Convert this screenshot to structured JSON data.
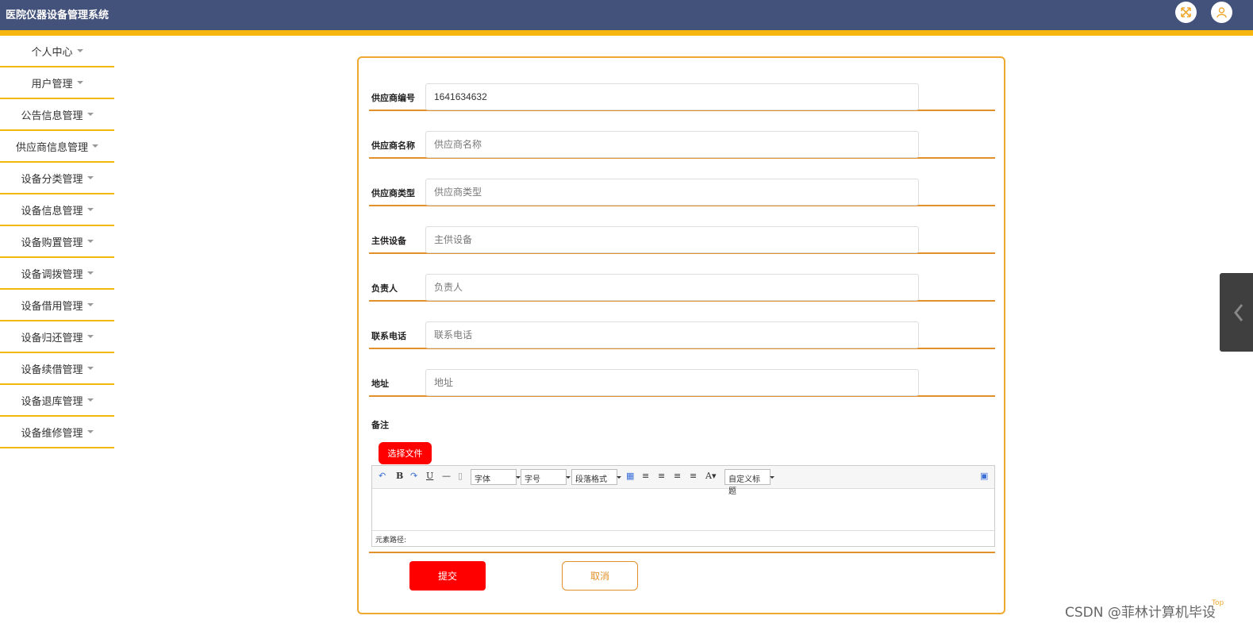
{
  "app": {
    "title": "医院仪器设备管理系统"
  },
  "header": {
    "icons": [
      "fullscreen-icon",
      "user-icon"
    ]
  },
  "sidebar": {
    "items": [
      {
        "label": "个人中心"
      },
      {
        "label": "用户管理"
      },
      {
        "label": "公告信息管理"
      },
      {
        "label": "供应商信息管理"
      },
      {
        "label": "设备分类管理"
      },
      {
        "label": "设备信息管理"
      },
      {
        "label": "设备购置管理"
      },
      {
        "label": "设备调拨管理"
      },
      {
        "label": "设备借用管理"
      },
      {
        "label": "设备归还管理"
      },
      {
        "label": "设备续借管理"
      },
      {
        "label": "设备退库管理"
      },
      {
        "label": "设备维修管理"
      }
    ]
  },
  "form": {
    "fields": [
      {
        "label": "供应商编号",
        "value": "1641634632",
        "placeholder": ""
      },
      {
        "label": "供应商名称",
        "value": "",
        "placeholder": "供应商名称"
      },
      {
        "label": "供应商类型",
        "value": "",
        "placeholder": "供应商类型"
      },
      {
        "label": "主供设备",
        "value": "",
        "placeholder": "主供设备"
      },
      {
        "label": "负责人",
        "value": "",
        "placeholder": "负责人"
      },
      {
        "label": "联系电话",
        "value": "",
        "placeholder": "联系电话"
      },
      {
        "label": "地址",
        "value": "",
        "placeholder": "地址"
      }
    ],
    "note_label": "备注",
    "choose_file_label": "选择文件",
    "editor": {
      "font_select": "字体",
      "size_select": "字号",
      "paragraph_select": "段落格式",
      "custom_title_select": "自定义标题",
      "path_label": "元素路径:"
    },
    "submit_label": "提交",
    "cancel_label": "取消"
  },
  "watermark": "CSDN @菲林计算机毕设",
  "top_link": "Top",
  "colors": {
    "header": "#43527a",
    "accent": "#f5b70e",
    "border": "#e2902a",
    "primary_button": "#ff0000"
  }
}
